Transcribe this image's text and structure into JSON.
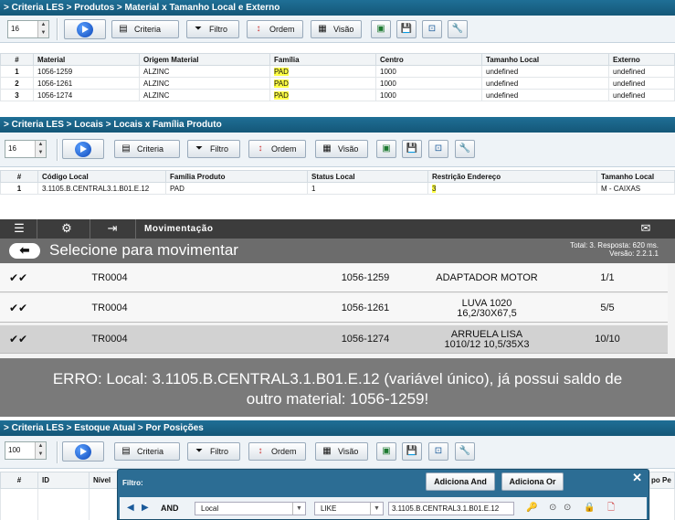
{
  "section1": {
    "breadcrumb": "> Criteria LES > Produtos > Material x Tamanho Local e Externo",
    "spin_value": "16",
    "buttons": {
      "criteria": "Criteria",
      "filtro": "Filtro",
      "ordem": "Ordem",
      "visao": "Visão"
    },
    "columns": [
      "#",
      "Material",
      "Origem Material",
      "Família",
      "Centro",
      "Tamanho Local",
      "Externo"
    ],
    "rows": [
      [
        "1",
        "1056-1259",
        "ALZINC",
        "PAD",
        "1000",
        "undefined",
        "undefined"
      ],
      [
        "2",
        "1056-1261",
        "ALZINC",
        "PAD",
        "1000",
        "undefined",
        "undefined"
      ],
      [
        "3",
        "1056-1274",
        "ALZINC",
        "PAD",
        "1000",
        "undefined",
        "undefined"
      ]
    ]
  },
  "section2": {
    "breadcrumb": "> Criteria LES > Locais > Locais x Família Produto",
    "spin_value": "16",
    "buttons": {
      "criteria": "Criteria",
      "filtro": "Filtro",
      "ordem": "Ordem",
      "visao": "Visão"
    },
    "columns": [
      "#",
      "Código Local",
      "Família Produto",
      "Status Local",
      "Restrição Endereço",
      "Tamanho Local"
    ],
    "rows": [
      [
        "1",
        "3.1105.B.CENTRAL3.1.B01.E.12",
        "PAD",
        "1",
        "3",
        "M - CAIXAS"
      ]
    ]
  },
  "mobile": {
    "header_title": "Movimentação",
    "page_title": "Selecione para movimentar",
    "info_line1": "Total: 3. Resposta: 620 ms.",
    "info_line2": "Versão: 2.2.1.1",
    "rows": [
      {
        "code": "TR0004",
        "material": "1056-1259",
        "desc1": "ADAPTADOR MOTOR",
        "desc2": "",
        "qty": "1/1"
      },
      {
        "code": "TR0004",
        "material": "1056-1261",
        "desc1": "LUVA 1020",
        "desc2": "16,2/30X67,5",
        "qty": "5/5"
      },
      {
        "code": "TR0004",
        "material": "1056-1274",
        "desc1": "ARRUELA LISA",
        "desc2": "1010/12 10,5/35X3",
        "qty": "10/10"
      }
    ]
  },
  "error": {
    "line1": "ERRO: Local: 3.1105.B.CENTRAL3.1.B01.E.12 (variável único), já possui saldo de",
    "line2": "outro material: 1056-1259!"
  },
  "section3": {
    "breadcrumb": "> Criteria LES > Estoque Atual > Por Posições",
    "spin_value": "100",
    "buttons": {
      "criteria": "Criteria",
      "filtro": "Filtro",
      "ordem": "Ordem",
      "visao": "Visão"
    },
    "columns": [
      "#",
      "ID",
      "Nível",
      "po Pe"
    ]
  },
  "filter": {
    "label": "Filtro:",
    "add_and": "Adiciona And",
    "add_or": "Adiciona Or",
    "and_label": "AND",
    "field": "Local",
    "operator": "LIKE",
    "value": "3.1105.B.CENTRAL3.1.B01.E.12"
  },
  "colors": {
    "header_blue": "#1a6488",
    "highlight": "#ffff44",
    "mobile_dark": "#3c3c3c",
    "error_bg": "#7a7a7a"
  }
}
